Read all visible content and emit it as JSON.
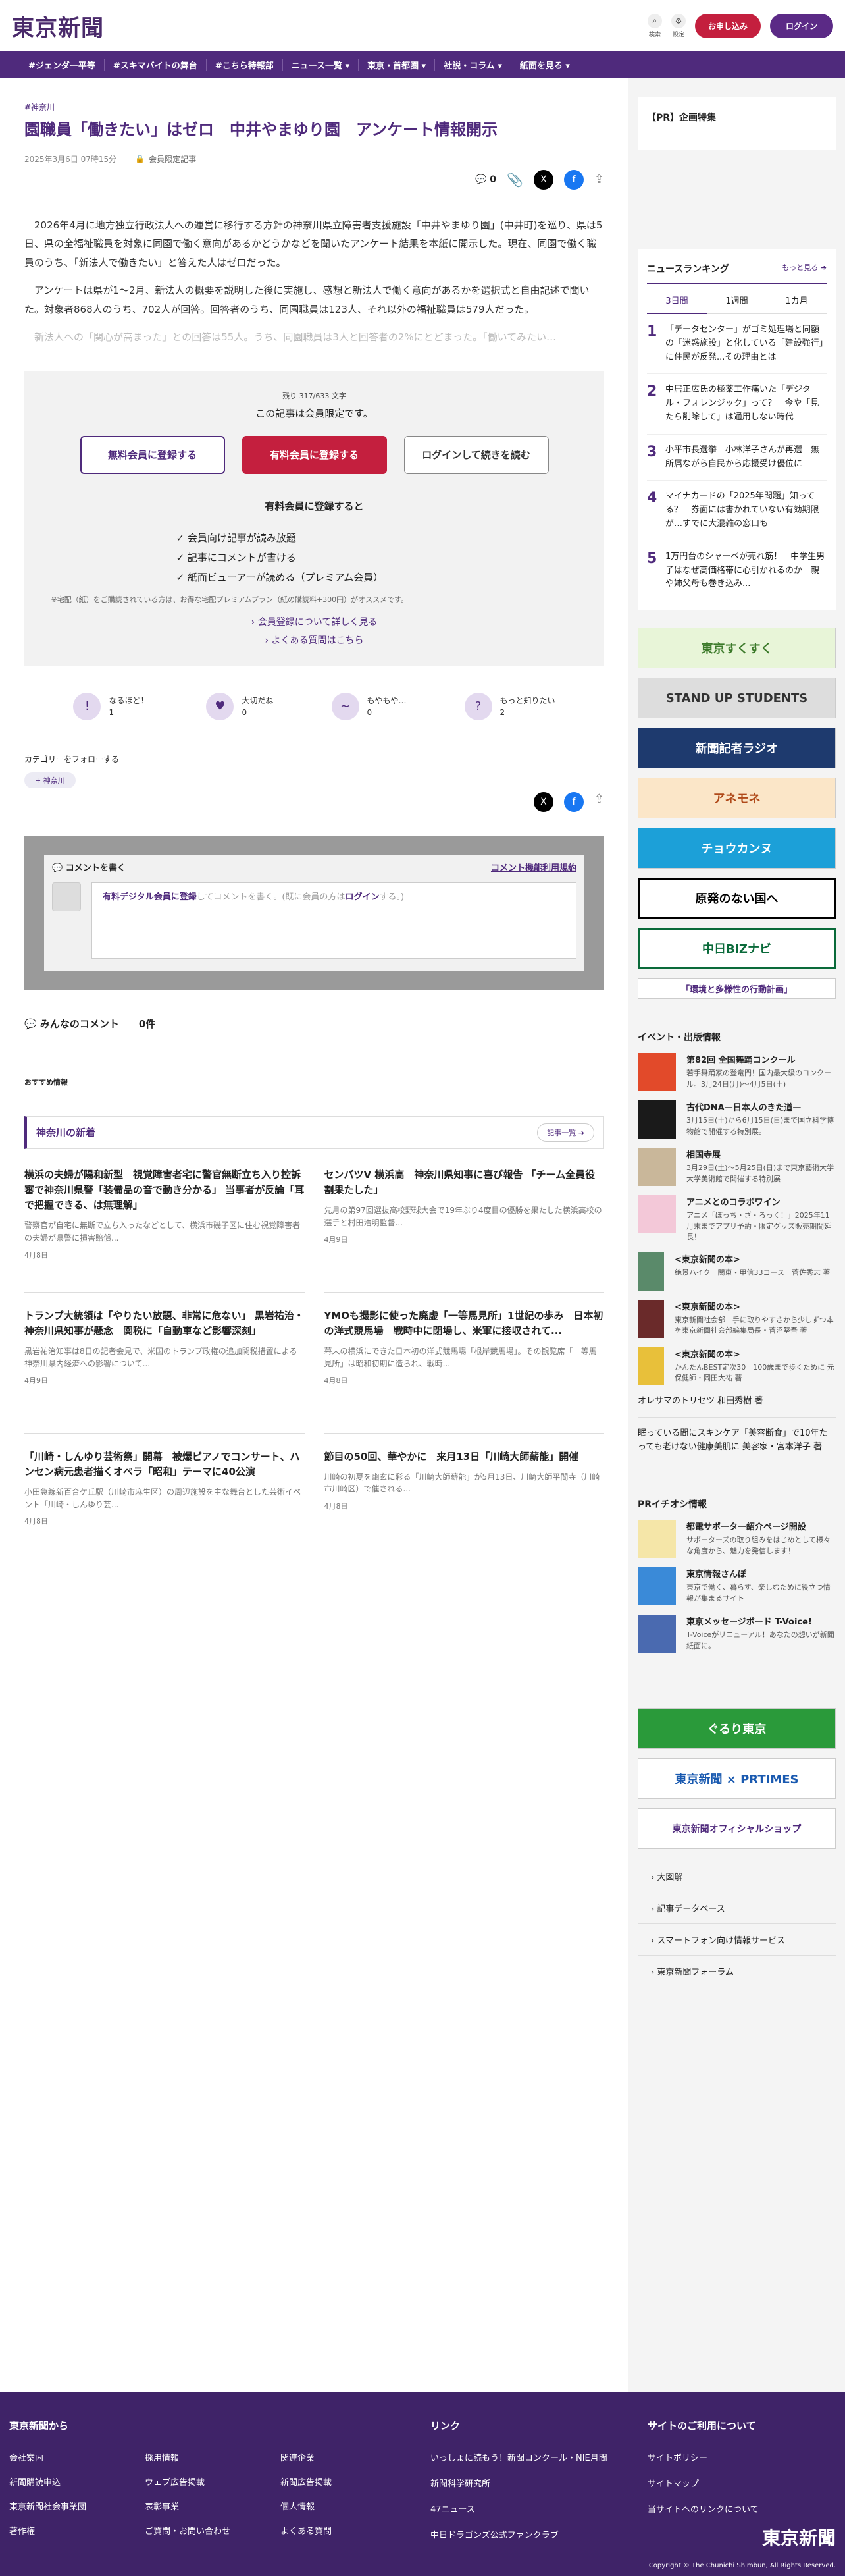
{
  "header": {
    "logo": "東京新聞",
    "search": "検索",
    "settings": "設定",
    "signup": "お申し込み",
    "login": "ログイン"
  },
  "nav": [
    "#ジェンダー平等",
    "#スキマバイトの舞台",
    "#こちら特報部",
    "ニュース一覧 ▾",
    "東京・首都圏 ▾",
    "社説・コラム ▾",
    "紙面を見る ▾"
  ],
  "article": {
    "tag": "#神奈川",
    "title": "園職員「働きたい」はゼロ　中井やまゆり園　アンケート情報開示",
    "date": "2025年3月6日 07時15分",
    "members": "会員限定記事",
    "comment_count": "0",
    "paragraphs": [
      "2026年4月に地方独立行政法人への運営に移行する方針の神奈川県立障害者支援施設「中井やまゆり園」(中井町)を巡り、県は5日、県の全福祉職員を対象に同園で働く意向があるかどうかなどを聞いたアンケート結果を本紙に開示した。現在、同園で働く職員のうち、「新法人で働きたい」と答えた人はゼロだった。",
      "アンケートは県が1〜2月、新法人の概要を説明した後に実施し、感想と新法人で働く意向があるかを選択式と自由記述で聞いた。対象者868人のうち、702人が回答。回答者のうち、同園職員は123人、それ以外の福祉職員は579人だった。"
    ],
    "fade": "新法人への「関心が高まった」との回答は55人。うち、同園職員は3人と回答者の2%にとどまった。「働いてみたい…"
  },
  "paywall": {
    "remain": "残り 317/633 文字",
    "title": "この記事は会員限定です。",
    "free": "無料会員に登録する",
    "paid": "有料会員に登録する",
    "login": "ログインして続きを読む",
    "benefits_title": "有料会員に登録すると",
    "benefits": [
      "会員向け記事が読み放題",
      "記事にコメントが書ける",
      "紙面ビューアーが読める（プレミアム会員）"
    ],
    "note": "※宅配（紙）をご購読されている方は、お得な宅配プレミアムプラン（紙の購読料+300円）がオススメです。",
    "link1": "会員登録について詳しく見る",
    "link2": "よくある質問はこちら"
  },
  "reactions": [
    {
      "label": "なるほど！",
      "count": "1",
      "icon": "!"
    },
    {
      "label": "大切だね",
      "count": "0",
      "icon": "♥"
    },
    {
      "label": "もやもや…",
      "count": "0",
      "icon": "∼"
    },
    {
      "label": "もっと知りたい",
      "count": "2",
      "icon": "?"
    }
  ],
  "follow": {
    "label": "カテゴリーをフォローする",
    "chip": "神奈川"
  },
  "comment": {
    "head": "コメントを書く",
    "policy": "コメント機能利用規約",
    "placeholder_link": "有料デジタル会員に登録",
    "placeholder_mid": "してコメントを書く。(既に会員の方は",
    "placeholder_login": "ログイン",
    "placeholder_end": "する。)",
    "everyone": "みんなのコメント",
    "count": "0件"
  },
  "recommend": {
    "label": "おすすめ情報",
    "area": "神奈川の新着",
    "more": "記事一覧 ➔"
  },
  "articles": [
    {
      "h": "横浜の夫婦が陽和新型　視覚障害者宅に警官無断立ち入り控訴審で神奈川県警「装備品の音で動き分かる」 当事者が反論「耳で把握できる、は無理解」",
      "b": "警察官が自宅に無断で立ち入ったなどとして、横浜市磯子区に住む視覚障害者の夫婦が県警に損害賠償...",
      "d": "4月8日"
    },
    {
      "h": "センバツV 横浜高　神奈川県知事に喜び報告 「チーム全員役割果たした」",
      "b": "先月の第97回選抜高校野球大会で19年ぶり4度目の優勝を果たした横浜高校の選手と村田浩明監督...",
      "d": "4月9日"
    },
    {
      "h": "トランプ大統領は「やりたい放題、非常に危ない」 黒岩祐治・神奈川県知事が懸念　関税に「自動車など影響深刻」",
      "b": "黒岩祐治知事は8日の記者会見で、米国のトランプ政権の追加関税措置による神奈川県内経済への影響について...",
      "d": "4月9日"
    },
    {
      "h": "YMOも撮影に使った廃虚「一等馬見所」1世紀の歩み　日本初の洋式競馬場　戦時中に閉場し、米軍に接収されて...",
      "b": "幕末の横浜にできた日本初の洋式競馬場「根岸競馬場」。その観覧席「一等馬見所」は昭和初期に造られ、戦時...",
      "d": "4月8日"
    },
    {
      "h": "「川崎・しんゆり芸術祭」開幕　被爆ピアノでコンサート、ハンセン病元患者描くオペラ「昭和」テーマに40公演",
      "b": "小田急線新百合ケ丘駅（川崎市麻生区）の周辺施設を主な舞台とした芸術イベント「川崎・しんゆり芸...",
      "d": "4月8日"
    },
    {
      "h": "節目の50回、華やかに　来月13日「川崎大師薪能」開催",
      "b": "川崎の初夏を幽玄に彩る「川崎大師薪能」が5月13日、川崎大師平間寺（川崎市川崎区）で催される...",
      "d": "4月8日"
    }
  ],
  "side": {
    "pr": "【PR】企画特集",
    "ranking": "ニュースランキング",
    "more": "もっと見る ➔",
    "tabs": [
      "3日間",
      "1週間",
      "1カ月"
    ],
    "ranks": [
      {
        "n": "1",
        "t": "「データセンター」がゴミ処理場と同額の「迷惑施設」と化している「建設強行」に住民が反発...その理由とは"
      },
      {
        "n": "2",
        "t": "中居正広氏の極薬工作痛いた「デジタル・フォレンジック」って？　今や「見たら削除して」は通用しない時代"
      },
      {
        "n": "3",
        "t": "小平市長選挙　小林洋子さんが再選　無所属ながら自民から応援受け優位に"
      },
      {
        "n": "4",
        "t": "マイナカードの「2025年問題」知ってる？　券面には書かれていない有効期限が…すでに大混雑の窓口も"
      },
      {
        "n": "5",
        "t": "1万円台のシャーベが売れ筋！　中学生男子はなぜ高価格帯に心引かれるのか　親や姉父母も巻き込み..."
      }
    ],
    "banners": [
      "東京すくすく",
      "STAND UP STUDENTS",
      "新聞記者ラジオ",
      "アネモネ",
      "チョウカンヌ",
      "原発のない国へ",
      "中日BiZナビ",
      "「環境と多様性の行動計画」"
    ],
    "events_h": "イベント・出版情報",
    "events": [
      {
        "a": "第82回 全国舞踊コンクール",
        "s": "若手舞踊家の登竜門！国内最大級のコンクール。3月24日(月)～4月5日(土)"
      },
      {
        "a": "古代DNA—日本人のきた道—",
        "s": "3月15日(土)から6月15日(日)まで国立科学博物館で開催する特別展。"
      },
      {
        "a": "相国寺展",
        "s": "3月29日(土)～5月25日(日)まで東京藝術大学大学美術館で開催する特別展"
      },
      {
        "a": "アニメとのコラボワイン",
        "s": "アニメ「ぼっち・ざ・ろっく！」2025年11月末までアプリ予約・限定グッズ販売期間延長！"
      },
      {
        "a": "<東京新聞の本>",
        "s": "絶景ハイク　関東・甲信33コース　菅佐秀志 著"
      },
      {
        "a": "<東京新聞の本>",
        "s": "東京新聞社会部　手に取りやすさから少しずつ本を東京新聞社会部編集局長・菅沼堅吾 著"
      },
      {
        "a": "<東京新聞の本>",
        "s": "かんたんBEST定次30　100歳まで歩くために 元保健師・岡田大祐 著"
      }
    ],
    "links": [
      "オレサマのトリセツ 和田秀樹 著",
      "眠っている間にスキンケア「美容断食」で10年たっても老けない健康美肌に 美容家・宮本洋子 著"
    ],
    "prtimes_h": "PRイチオシ情報",
    "prtimes": [
      {
        "a": "都電サポーター紹介ページ開設",
        "s": "サポーターズの取り組みをはじめとして様々な角度から、魅力を発信します！"
      },
      {
        "a": "東京情報さんぽ",
        "s": "東京で働く、暮らす、楽しむために役立つ情報が集まるサイト"
      },
      {
        "a": "東京メッセージボード T-Voice!",
        "s": "T-Voiceがリニューアル！あなたの想いが新聞紙面に。"
      }
    ],
    "banners2": [
      "ぐるり東京",
      "東京新聞 × PRTIMES",
      "東京新聞オフィシャルショップ"
    ],
    "site_links": [
      "大図解",
      "記事データベース",
      "スマートフォン向け情報サービス",
      "東京新聞フォーラム"
    ]
  },
  "footer": {
    "h1": "東京新聞から",
    "col1": [
      "会社案内",
      "採用情報",
      "関連企業",
      "新聞購読申込",
      "ウェブ広告掲載",
      "新聞広告掲載",
      "東京新聞社会事業団",
      "表彰事業",
      "個人情報",
      "著作権",
      "ご質問・お問い合わせ",
      "よくある質問"
    ],
    "h2": "リンク",
    "col2": [
      "いっしょに読もう！新聞コンクール・NIE月間",
      "新聞科学研究所",
      "47ニュース",
      "中日ドラゴンズ公式ファンクラブ"
    ],
    "h3": "サイトのご利用について",
    "col3": [
      "サイトポリシー",
      "サイトマップ",
      "当サイトへのリンクについて"
    ],
    "logo": "東京新聞",
    "copy": "Copyright © The Chunichi Shimbun, All Rights Reserved."
  },
  "colors": {
    "brand": "#4f2a7c",
    "accent": "#c41f3e"
  }
}
